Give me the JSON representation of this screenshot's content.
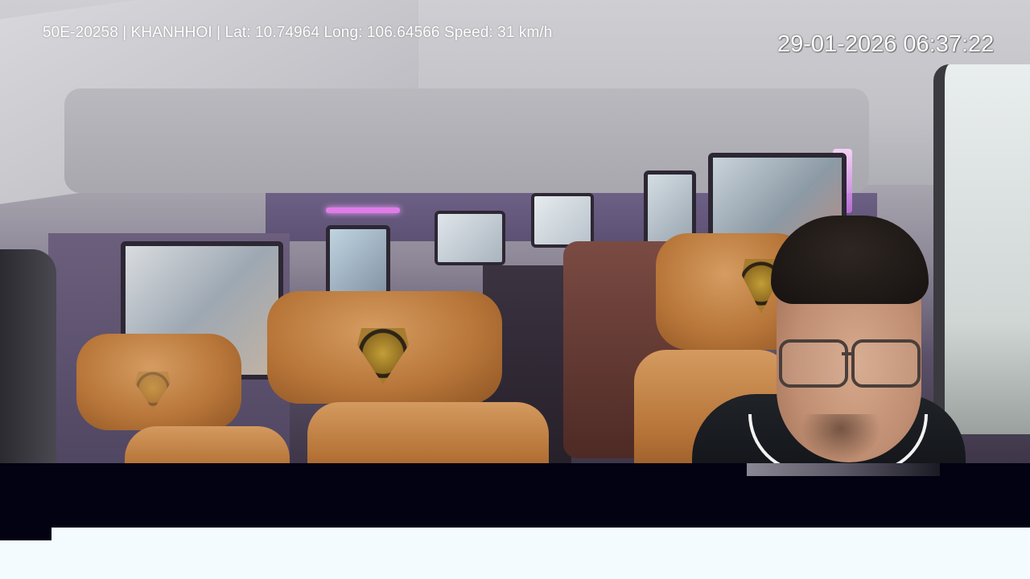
{
  "overlay": {
    "info": "50E-20258 | KHANHHOI | Lat: 10.74964 Long: 106.64566 Speed: 31 km/h",
    "datetime": "29-01-2026 06:37:22"
  },
  "colors": {
    "seat_leather": "#b9773a",
    "interior_purple": "#5a4a78",
    "letterbox": "#020212",
    "background": "#f4fbff"
  }
}
